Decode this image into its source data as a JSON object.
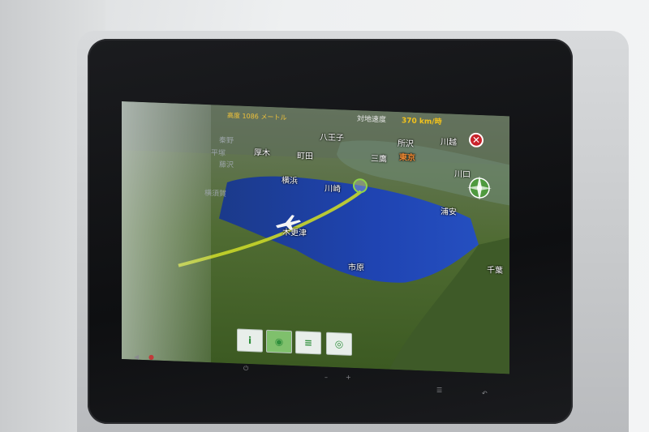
{
  "flight_map": {
    "altitude": "高度 1086 メートル",
    "ground_speed_label": "対地速度",
    "ground_speed_value": "370 km/時",
    "cities": {
      "hachioji": "八王子",
      "tokorozawa": "所沢",
      "kawagoe": "川越",
      "hadano": "秦野",
      "atsugi": "厚木",
      "machida": "町田",
      "mitaka": "三鷹",
      "tokyo": "東京",
      "hiratsuka": "平塚",
      "fujisawa": "藤沢",
      "kawaguchi": "川口",
      "yokohama": "横浜",
      "kawasaki": "川崎",
      "yokosuka": "横須賀",
      "urayasu": "浦安",
      "kisarazu": "木更津",
      "ichihara": "市原",
      "chiba": "千葉"
    },
    "close_icon": "close-icon",
    "compass_icon": "compass-icon",
    "plane_icon": "airplane-icon"
  },
  "toolbar": {
    "buttons": [
      {
        "icon": "info-icon",
        "glyph": "i"
      },
      {
        "icon": "eye-icon",
        "glyph": "◉"
      },
      {
        "icon": "list-icon",
        "glyph": "≡"
      },
      {
        "icon": "view-icon",
        "glyph": "◎"
      }
    ]
  },
  "bezel": {
    "mute_glyph": "◀",
    "power_glyph": "⏻",
    "vol_down": "–",
    "vol_up": "+",
    "menu_glyph": "☰",
    "back_glyph": "↶"
  },
  "colors": {
    "route": "#c9d72a",
    "water": "#1a3fa8",
    "land": "#4f6b32",
    "speed_value": "#f2c21c",
    "close_button": "#c9232b"
  }
}
